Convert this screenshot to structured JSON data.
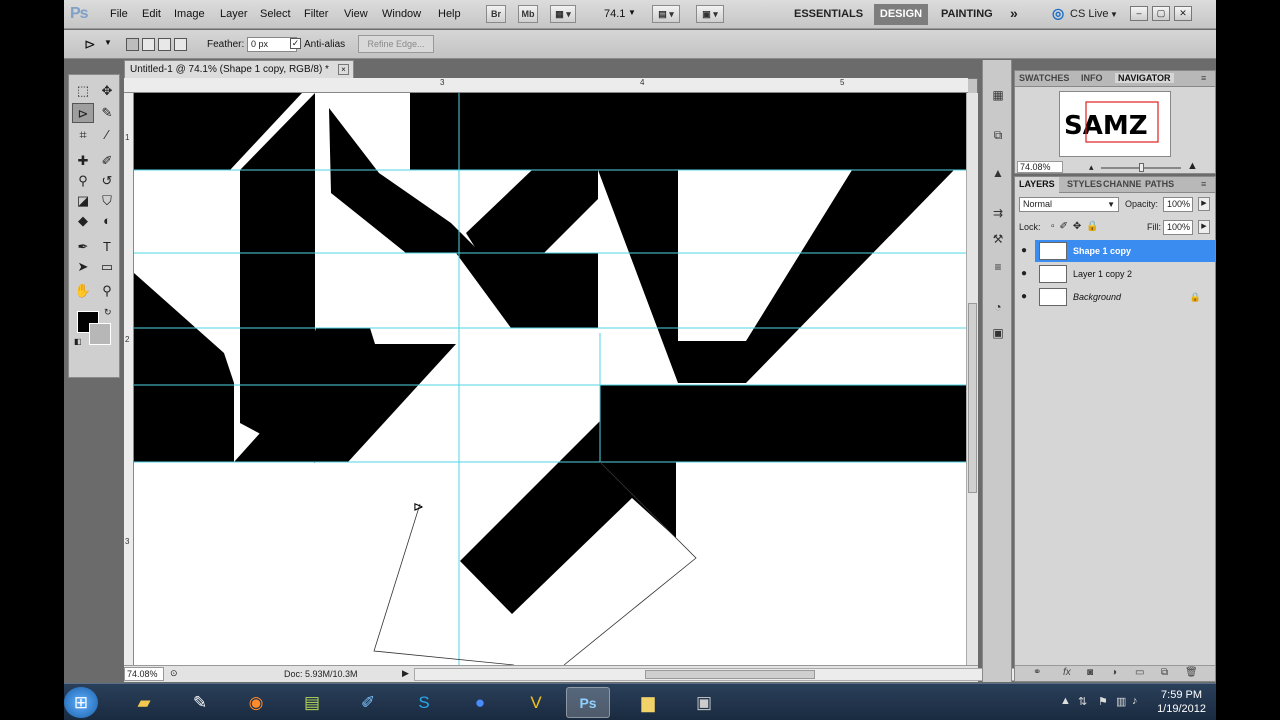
{
  "app": {
    "logo": "Ps"
  },
  "menu": [
    "File",
    "Edit",
    "Image",
    "Layer",
    "Select",
    "Filter",
    "View",
    "Window",
    "Help"
  ],
  "appbar": {
    "bridge": "Br",
    "minibridge": "Mb",
    "zoom": "74.1"
  },
  "workspaces": {
    "essentials": "ESSENTIALS",
    "design": "DESIGN",
    "painting": "PAINTING",
    "more": "»"
  },
  "cslive": "CS Live",
  "options": {
    "feather_label": "Feather:",
    "feather_value": "0 px",
    "antialias_label": "Anti-alias",
    "antialias_checked": true,
    "refine_edge": "Refine Edge..."
  },
  "document": {
    "tab_title": "Untitled-1 @ 74.1% (Shape 1 copy, RGB/8) *",
    "close": "×",
    "ruler_h": [
      "3",
      "4",
      "5"
    ],
    "ruler_v": [
      "1",
      "2",
      "3"
    ],
    "status_zoom": "74.08%",
    "status_doc": "Doc: 5.93M/10.3M"
  },
  "navigator": {
    "tabs": [
      "SWATCHES",
      "INFO",
      "NAVIGATOR"
    ],
    "zoom": "74.08%"
  },
  "layers_panel": {
    "tabs": [
      "LAYERS",
      "STYLES",
      "CHANNE",
      "PATHS"
    ],
    "blend_mode": "Normal",
    "opacity_label": "Opacity:",
    "opacity": "100%",
    "lock_label": "Lock:",
    "fill_label": "Fill:",
    "fill": "100%",
    "layers": [
      {
        "name": "Shape 1 copy",
        "active": true
      },
      {
        "name": "Layer 1 copy 2",
        "active": false
      },
      {
        "name": "Background",
        "active": false,
        "locked": true
      }
    ]
  },
  "taskbar": {
    "clock_time": "7:59 PM",
    "clock_date": "1/19/2012",
    "apps": [
      "start-orb",
      "explorer",
      "paint",
      "firefox",
      "notepad",
      "flash",
      "skype",
      "media",
      "norton",
      "photoshop",
      "folder",
      "video"
    ]
  },
  "colors": {
    "guide": "#4fd6e6",
    "selection": "#3b8cf0",
    "foreground": "#000000",
    "background": "#ffffff"
  }
}
